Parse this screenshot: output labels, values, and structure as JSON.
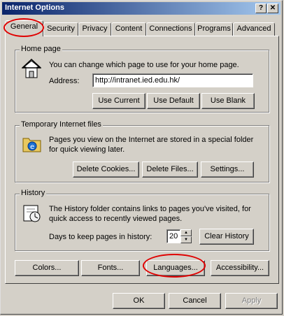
{
  "window": {
    "title": "Internet Options",
    "help_label": "?",
    "close_label": "✕"
  },
  "tabs": [
    "General",
    "Security",
    "Privacy",
    "Content",
    "Connections",
    "Programs",
    "Advanced"
  ],
  "home_page": {
    "group_title": "Home page",
    "description": "You can change which page to use for your home page.",
    "address_label": "Address:",
    "address_value": "http://intranet.ied.edu.hk/",
    "use_current": "Use Current",
    "use_default": "Use Default",
    "use_blank": "Use Blank"
  },
  "temp_files": {
    "group_title": "Temporary Internet files",
    "description_line1": "Pages you view on the Internet are stored in a special folder",
    "description_line2": "for quick viewing later.",
    "delete_cookies": "Delete Cookies...",
    "delete_files": "Delete Files...",
    "settings": "Settings..."
  },
  "history": {
    "group_title": "History",
    "description_line1": "The History folder contains links to pages you've visited, for",
    "description_line2": "quick access to recently viewed pages.",
    "days_label": "Days to keep pages in history:",
    "days_value": "20",
    "clear_history": "Clear History"
  },
  "bottom_buttons": {
    "colors": "Colors...",
    "fonts": "Fonts...",
    "languages": "Languages...",
    "accessibility": "Accessibility..."
  },
  "dialog_buttons": {
    "ok": "OK",
    "cancel": "Cancel",
    "apply": "Apply"
  },
  "colors": {
    "title_gradient_start": "#0a246a",
    "title_gradient_end": "#a6caf0",
    "face": "#d4d0c8",
    "annotation_ring": "#e00000"
  }
}
